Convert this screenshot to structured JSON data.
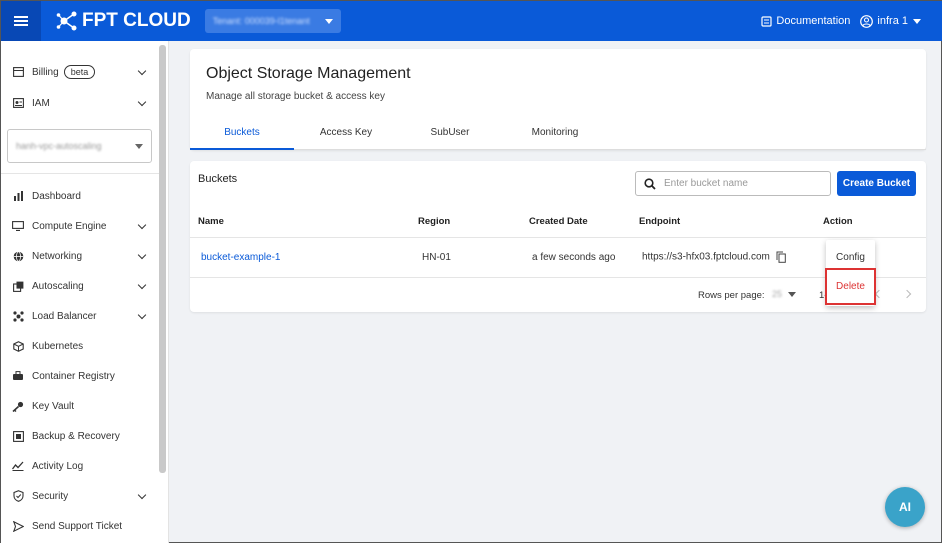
{
  "app": {
    "logo_text": "FPT CLOUD",
    "tenant": "Tenant: 000039-l1tenant"
  },
  "topbar": {
    "documentation": "Documentation",
    "user": "infra 1"
  },
  "sidebar": {
    "billing": {
      "label": "Billing",
      "badge": "beta"
    },
    "iam": "IAM",
    "project": "hanh-vpc-autoscaling",
    "items": [
      {
        "label": "Dashboard",
        "icon": "bar-chart-icon",
        "expand": false
      },
      {
        "label": "Compute Engine",
        "icon": "monitor-icon",
        "expand": true
      },
      {
        "label": "Networking",
        "icon": "globe-icon",
        "expand": true
      },
      {
        "label": "Autoscaling",
        "icon": "autoscaling-icon",
        "expand": true
      },
      {
        "label": "Load Balancer",
        "icon": "load-balancer-icon",
        "expand": true
      },
      {
        "label": "Kubernetes",
        "icon": "cube-icon",
        "expand": false
      },
      {
        "label": "Container Registry",
        "icon": "container-icon",
        "expand": false
      },
      {
        "label": "Key Vault",
        "icon": "key-icon",
        "expand": false
      },
      {
        "label": "Backup & Recovery",
        "icon": "backup-icon",
        "expand": false
      },
      {
        "label": "Activity Log",
        "icon": "activity-icon",
        "expand": false
      },
      {
        "label": "Security",
        "icon": "shield-icon",
        "expand": true
      },
      {
        "label": "Send Support Ticket",
        "icon": "send-icon",
        "expand": false
      }
    ]
  },
  "header": {
    "title": "Object Storage Management",
    "subtitle": "Manage all storage bucket & access key",
    "tabs": [
      "Buckets",
      "Access Key",
      "SubUser",
      "Monitoring"
    ],
    "active_tab": "Buckets"
  },
  "buckets": {
    "title": "Buckets",
    "search_placeholder": "Enter bucket name",
    "create_button": "Create Bucket",
    "columns": [
      "Name",
      "Region",
      "Created Date",
      "Endpoint",
      "Action"
    ],
    "rows": [
      {
        "name": "bucket-example-1",
        "region": "HN-01",
        "created": "a few seconds ago",
        "endpoint": "https://s3-hfx03.fptcloud.com"
      }
    ],
    "rows_per_page_label": "Rows per page:",
    "rows_per_page": "25",
    "range": "1-"
  },
  "action_menu": {
    "config": "Config",
    "delete": "Delete"
  },
  "ai_button": "AI",
  "colors": {
    "primary": "#0a5ad8",
    "danger": "#dd3333"
  }
}
